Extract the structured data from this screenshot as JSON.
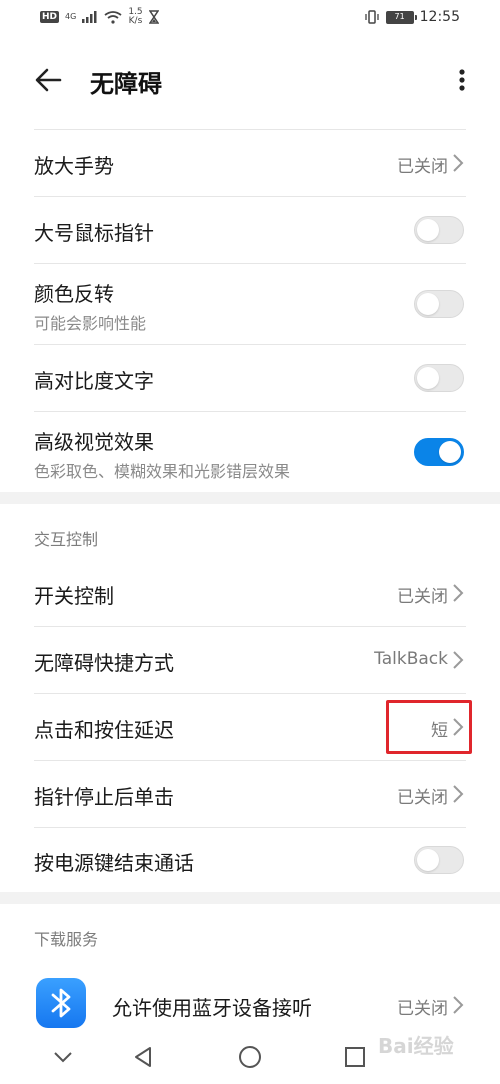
{
  "status_bar": {
    "hd_badge": "HD",
    "network": "4G",
    "speed_value": "1.5",
    "speed_unit": "K/s",
    "battery": "71",
    "time": "12:55"
  },
  "app_bar": {
    "title": "无障碍",
    "back_icon": "arrow-left-icon",
    "more_icon": "more-vertical-icon"
  },
  "display_items": [
    {
      "title": "放大手势",
      "value": "已关闭",
      "control": "chevron"
    },
    {
      "title": "大号鼠标指针",
      "control": "toggle",
      "on": false
    },
    {
      "title": "颜色反转",
      "subtitle": "可能会影响性能",
      "control": "toggle",
      "on": false
    },
    {
      "title": "高对比度文字",
      "control": "toggle",
      "on": false
    },
    {
      "title": "高级视觉效果",
      "subtitle": "色彩取色、模糊效果和光影错层效果",
      "control": "toggle",
      "on": true
    }
  ],
  "interaction_section": {
    "header": "交互控制",
    "items": [
      {
        "title": "开关控制",
        "value": "已关闭",
        "control": "chevron"
      },
      {
        "title": "无障碍快捷方式",
        "value": "TalkBack",
        "control": "chevron"
      },
      {
        "title": "点击和按住延迟",
        "value": "短",
        "control": "chevron",
        "highlighted": true
      },
      {
        "title": "指针停止后单击",
        "value": "已关闭",
        "control": "chevron"
      },
      {
        "title": "按电源键结束通话",
        "control": "toggle",
        "on": false
      }
    ]
  },
  "download_section": {
    "header": "下载服务",
    "items": [
      {
        "title": "允许使用蓝牙设备接听",
        "value": "已关闭",
        "icon": "bluetooth-icon",
        "control": "chevron"
      }
    ]
  },
  "nav_bar": {
    "items": [
      "chevron-down-icon",
      "back-triangle-icon",
      "home-circle-icon",
      "recents-square-icon"
    ]
  },
  "watermark": "Bai经验",
  "colors": {
    "accent": "#0a84e8",
    "highlight_box": "#e0262c",
    "section_bg": "#f2f2f2",
    "secondary_text": "#7a7a7a"
  }
}
